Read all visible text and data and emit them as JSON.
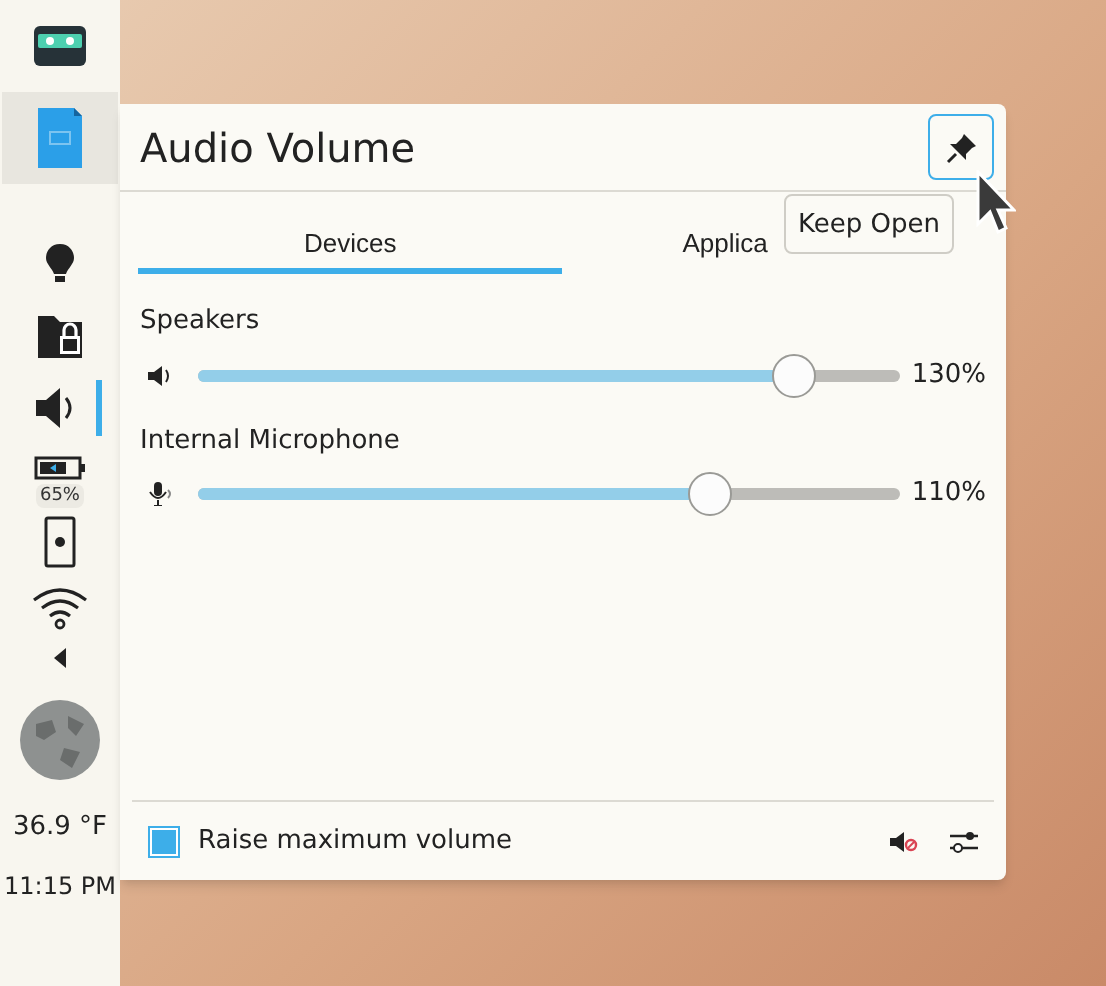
{
  "panel": {
    "battery_label": "65%",
    "temperature": "36.9 °F",
    "clock": "11:15 PM"
  },
  "popup": {
    "title": "Audio Volume",
    "pin_tooltip": "Keep Open",
    "tabs": [
      {
        "label": "Devices",
        "selected": true
      },
      {
        "label": "Applica",
        "selected": false
      }
    ],
    "devices": [
      {
        "name": "Speakers",
        "kind": "speaker",
        "level": 0.85,
        "reading": "130%"
      },
      {
        "name": "Internal Microphone",
        "kind": "microphone",
        "level": 0.73,
        "reading": "110%"
      }
    ],
    "raise_max": {
      "label": "Raise maximum volume",
      "checked": true
    }
  }
}
